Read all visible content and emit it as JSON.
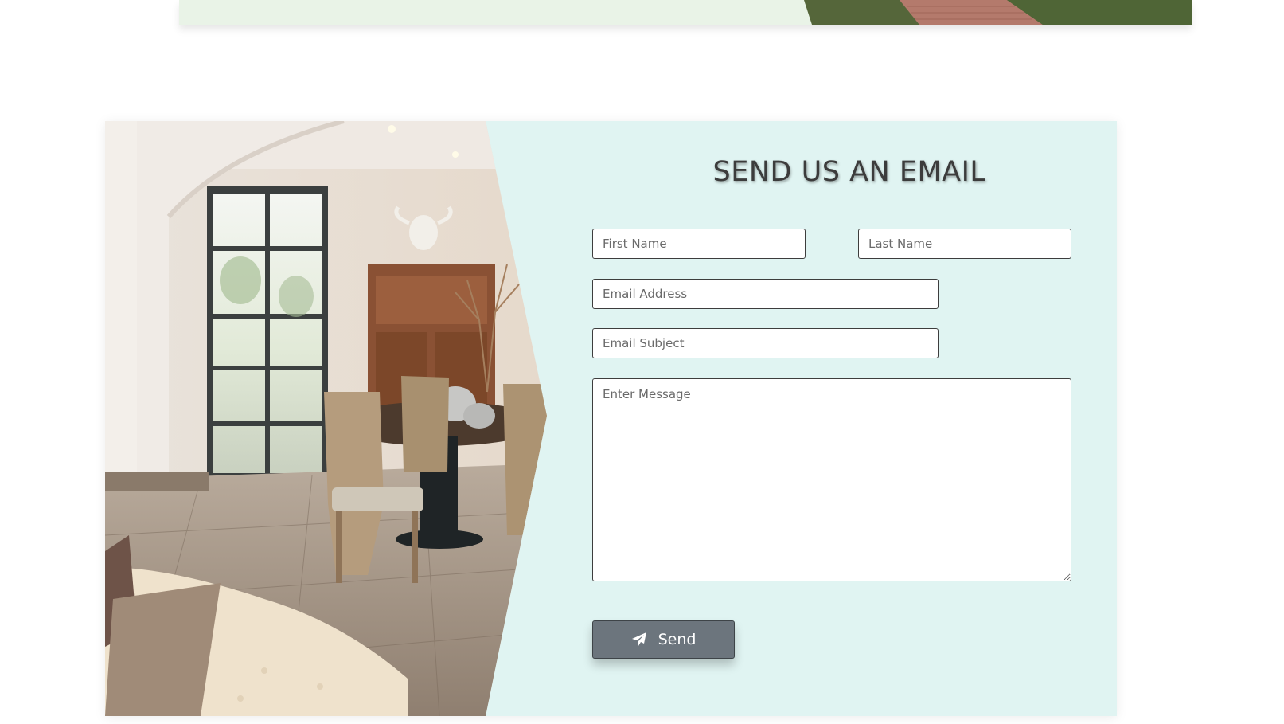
{
  "contact": {
    "title": "SEND US AN EMAIL",
    "first_name_placeholder": "First Name",
    "last_name_placeholder": "Last Name",
    "email_placeholder": "Email Address",
    "subject_placeholder": "Email Subject",
    "message_placeholder": "Enter Message",
    "send_label": "Send",
    "send_icon": "paper-plane-icon"
  },
  "colors": {
    "panel_bg": "#e0f4f2",
    "button_bg": "#6c757d",
    "top_card_bg": "#e9f3e7"
  }
}
